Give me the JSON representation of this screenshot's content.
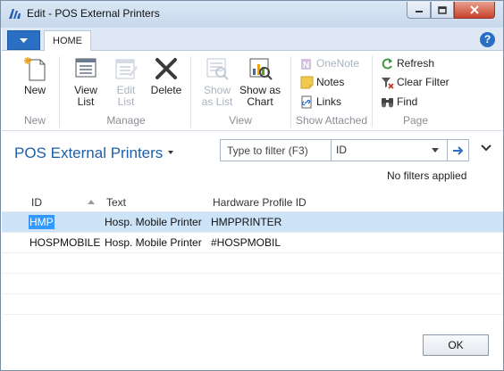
{
  "window": {
    "title": "Edit - POS External Printers",
    "controls": [
      "minimize-icon",
      "maximize-icon",
      "close-icon"
    ]
  },
  "ribbon": {
    "tabs": [
      {
        "label": "HOME",
        "active": true
      }
    ],
    "groups": {
      "new": {
        "label": "New",
        "buttons": [
          {
            "label": "New",
            "icon": "new-document-icon",
            "enabled": true
          }
        ]
      },
      "manage": {
        "label": "Manage",
        "buttons": [
          {
            "label": "View\nList",
            "line1": "View",
            "line2": "List",
            "icon": "view-list-icon",
            "enabled": true
          },
          {
            "label": "Edit\nList",
            "line1": "Edit",
            "line2": "List",
            "icon": "edit-list-icon",
            "enabled": false
          },
          {
            "label": "Delete",
            "icon": "delete-icon",
            "enabled": true
          }
        ]
      },
      "view": {
        "label": "View",
        "buttons": [
          {
            "line1": "Show",
            "line2": "as List",
            "icon": "show-as-list-icon",
            "enabled": false
          },
          {
            "line1": "Show as",
            "line2": "Chart",
            "icon": "show-as-chart-icon",
            "enabled": true
          }
        ]
      },
      "show_attached": {
        "label": "Show Attached",
        "buttons": [
          {
            "label": "OneNote",
            "icon": "onenote-icon",
            "enabled": false
          },
          {
            "label": "Notes",
            "icon": "notes-icon",
            "enabled": true
          },
          {
            "label": "Links",
            "icon": "links-icon",
            "enabled": true
          }
        ]
      },
      "page": {
        "label": "Page",
        "buttons": [
          {
            "label": "Refresh",
            "icon": "refresh-icon",
            "enabled": true
          },
          {
            "label": "Clear Filter",
            "icon": "clear-filter-icon",
            "enabled": true
          },
          {
            "label": "Find",
            "icon": "find-icon",
            "enabled": true
          }
        ]
      }
    }
  },
  "page": {
    "title": "POS External Printers",
    "filter": {
      "placeholder": "Type to filter (F3)",
      "field": "ID",
      "status": "No filters applied"
    }
  },
  "grid": {
    "columns": [
      "ID",
      "Text",
      "Hardware Profile ID"
    ],
    "sort_column": "ID",
    "rows": [
      {
        "id": "HMP",
        "text": "Hosp. Mobile Printer",
        "hardware_profile_id": "HMPPRINTER",
        "selected": true
      },
      {
        "id": "HOSPMOBILE",
        "text": "Hosp. Mobile Printer",
        "hardware_profile_id": "#HOSPMOBIL",
        "selected": false
      }
    ]
  },
  "footer": {
    "ok_label": "OK"
  },
  "colors": {
    "accent": "#2b6fc4",
    "title_blue": "#1d5fa8",
    "selection": "#cde3f7",
    "cell_highlight": "#3399ff"
  }
}
